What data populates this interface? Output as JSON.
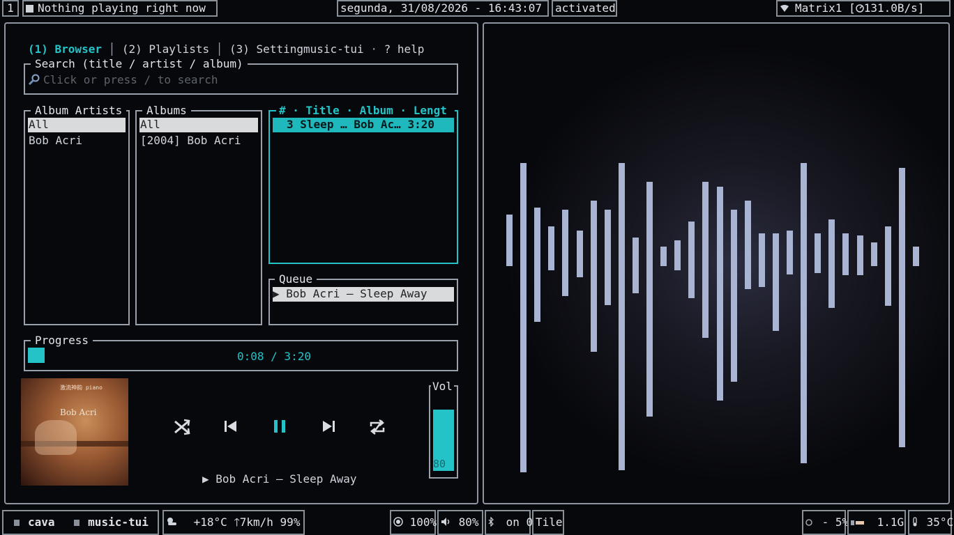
{
  "topbar": {
    "workspace": "1",
    "now_playing": "Nothing playing right now",
    "clock": "segunda, 31/08/2026 - 16:43:07",
    "status": "activated",
    "network": "Matrix1 [",
    "speed": "131.0B/s]"
  },
  "music": {
    "tabs": {
      "browser": "(1) Browser",
      "playlists": "(2) Playlists",
      "settings": "(3) Settingmusic-tui",
      "help": "? help"
    },
    "search": {
      "title": "Search (title / artist / album)",
      "placeholder": "Click or press / to search"
    },
    "artists": {
      "title": "Album Artists",
      "items": [
        "All",
        "Bob Acri"
      ]
    },
    "albums": {
      "title": "Albums",
      "items": [
        "All",
        "[2004] Bob Acri"
      ]
    },
    "tracks": {
      "header": {
        "num": "#",
        "title": "Title",
        "album": "Album",
        "length": "Lengt"
      },
      "rows": [
        {
          "num": "3",
          "title": "Sleep …",
          "album": "Bob Ac…",
          "length": "3:20"
        }
      ]
    },
    "queue": {
      "title": "Queue",
      "items": [
        "▶ Bob Acri — Sleep Away"
      ]
    },
    "progress": {
      "title": "Progress",
      "time": "0:08 / 3:20",
      "fraction": 0.04
    },
    "album_art": {
      "small_text": "激流神韵 piano",
      "artist": "Bob Acri"
    },
    "now_playing": "▶ Bob Acri — Sleep Away",
    "volume": {
      "title": "Vol",
      "value": "80",
      "level": 0.8
    }
  },
  "visualizer": {
    "bars": [
      [
        0.18,
        0.02
      ],
      [
        0.4,
        0.93
      ],
      [
        0.21,
        0.28
      ],
      [
        0.13,
        0.06
      ],
      [
        0.2,
        0.17
      ],
      [
        0.11,
        0.09
      ],
      [
        0.24,
        0.41
      ],
      [
        0.2,
        0.21
      ],
      [
        0.4,
        0.92
      ],
      [
        0.08,
        0.16
      ],
      [
        0.32,
        0.69
      ],
      [
        0.04,
        0.03
      ],
      [
        0.07,
        0.06
      ],
      [
        0.15,
        0.18
      ],
      [
        0.32,
        0.35
      ],
      [
        0.3,
        0.62
      ],
      [
        0.2,
        0.54
      ],
      [
        0.24,
        0.14
      ],
      [
        0.1,
        0.13
      ],
      [
        0.1,
        0.32
      ],
      [
        0.11,
        0.08
      ],
      [
        0.4,
        0.89
      ],
      [
        0.1,
        0.07
      ],
      [
        0.16,
        0.22
      ],
      [
        0.1,
        0.08
      ],
      [
        0.09,
        0.08
      ],
      [
        0.06,
        0.04
      ],
      [
        0.13,
        0.21
      ],
      [
        0.38,
        0.82
      ],
      [
        0.04,
        0.02
      ]
    ]
  },
  "bottombar": {
    "apps": [
      "cava",
      "music-tui"
    ],
    "weather": "+18°C 🡑7km/h 99%",
    "brightness": "100%",
    "volume": "80%",
    "bluetooth": "on 0",
    "layout": "Tile",
    "cpu": "- 5%",
    "memory": "1.1G",
    "temp": "35°C"
  }
}
